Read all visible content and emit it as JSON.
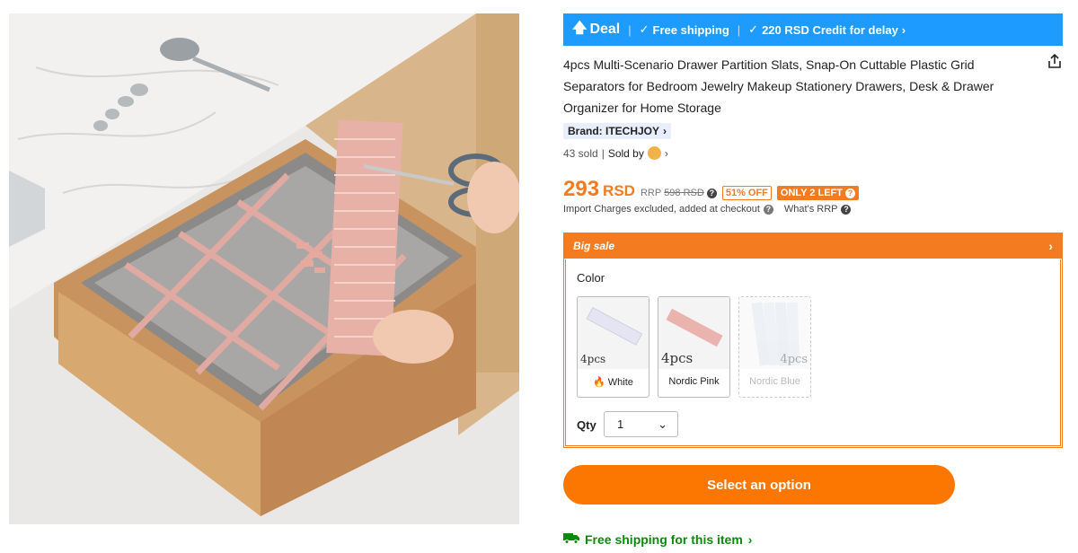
{
  "image": {
    "alt": ""
  },
  "deal_bar": {
    "deal_label": "Deal",
    "free_shipping": "Free shipping",
    "credit": "220 RSD Credit for delay",
    "icons": [
      "up-arrow-icon",
      "check-icon",
      "chevron-right-icon"
    ]
  },
  "product": {
    "title": "4pcs Multi-Scenario Drawer Partition Slats, Snap-On Cuttable Plastic Grid Separators for Bedroom Jewelry Makeup Stationery Drawers, Desk & Drawer Organizer for Home Storage",
    "brand": "Brand: ITECHJOY",
    "sold": "43 sold",
    "sold_by": "Sold by"
  },
  "price": {
    "amount": "293",
    "currency": "RSD",
    "rrp_label": "RRP",
    "rrp_value": "598 RSD",
    "discount": "51% OFF",
    "stock": "ONLY 2 LEFT",
    "import_note": "Import Charges excluded, added at checkout",
    "whats_rrp": "What's RRP"
  },
  "sale": {
    "header": "Big sale",
    "color_label": "Color",
    "options": [
      {
        "pcs": "4pcs",
        "name": "White",
        "selected": false,
        "available": true,
        "hot": true
      },
      {
        "pcs": "4pcs",
        "name": "Nordic Pink",
        "selected": false,
        "available": true,
        "hot": false
      },
      {
        "pcs": "4pcs",
        "name": "Nordic Blue",
        "selected": false,
        "available": false,
        "hot": false
      }
    ],
    "qty_label": "Qty",
    "qty_value": "1"
  },
  "actions": {
    "select_option": "Select an option",
    "free_shipping_item": "Free shipping for this item"
  },
  "colors": {
    "accent": "#fb7701",
    "deal_blue": "#1e9bff",
    "shipping_green": "#0a8a0a"
  }
}
